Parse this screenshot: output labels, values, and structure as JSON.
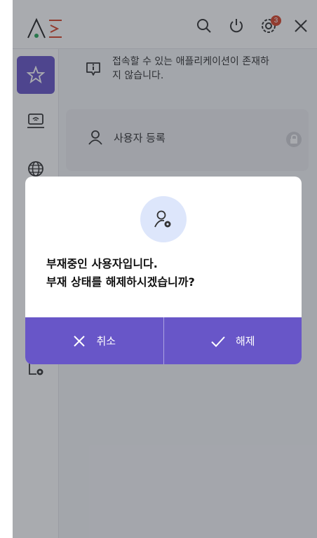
{
  "header": {
    "logo": "logo",
    "icons": {
      "search": "search-icon",
      "power": "power-icon",
      "notification": "gear-notification-icon",
      "close": "close-icon"
    },
    "notification_count": "3"
  },
  "sidebar": {
    "items": [
      {
        "icon": "star-icon",
        "active": true
      },
      {
        "icon": "laptop-icon"
      },
      {
        "icon": "globe-icon"
      },
      {
        "icon": "settings-icon"
      }
    ]
  },
  "main": {
    "info_message": "접속할 수 있는 애플리케이션이 존재하지 않습니다.",
    "card_label": "사용자 등록"
  },
  "modal": {
    "message_line1": "부재중인 사용자입니다.",
    "message_line2": "부재 상태를 해제하시겠습니까?",
    "cancel_label": "취소",
    "confirm_label": "해제"
  },
  "colors": {
    "accent": "#6856c8",
    "badge": "#d9452a",
    "icon_bg": "#dde6fb"
  }
}
